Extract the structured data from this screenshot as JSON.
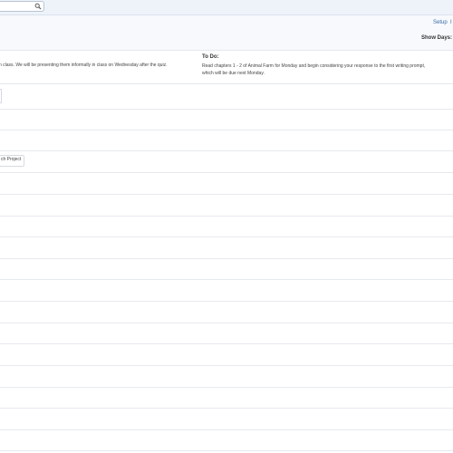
{
  "header": {
    "search_placeholder": "",
    "setup_label": "Setup",
    "extra_link_label": "I",
    "show_days_label": "Show Days:"
  },
  "notes": {
    "left_text": "n class. We will be presenting them informally in class on Wednesday after the quiz.",
    "todo_heading": "To Do:",
    "todo_line1": "Read chapters 1 - 2 of Animal Farm for Monday and begin considering your response to the first writing prompt,",
    "todo_line2": "which will be due next Monday."
  },
  "schedule": {
    "project_label": "ch Project"
  },
  "colors": {
    "header_bg": "#eef3fa",
    "link": "#3a6aa6",
    "divider": "#e6e9ee"
  },
  "icons": {
    "search": "search-icon"
  }
}
